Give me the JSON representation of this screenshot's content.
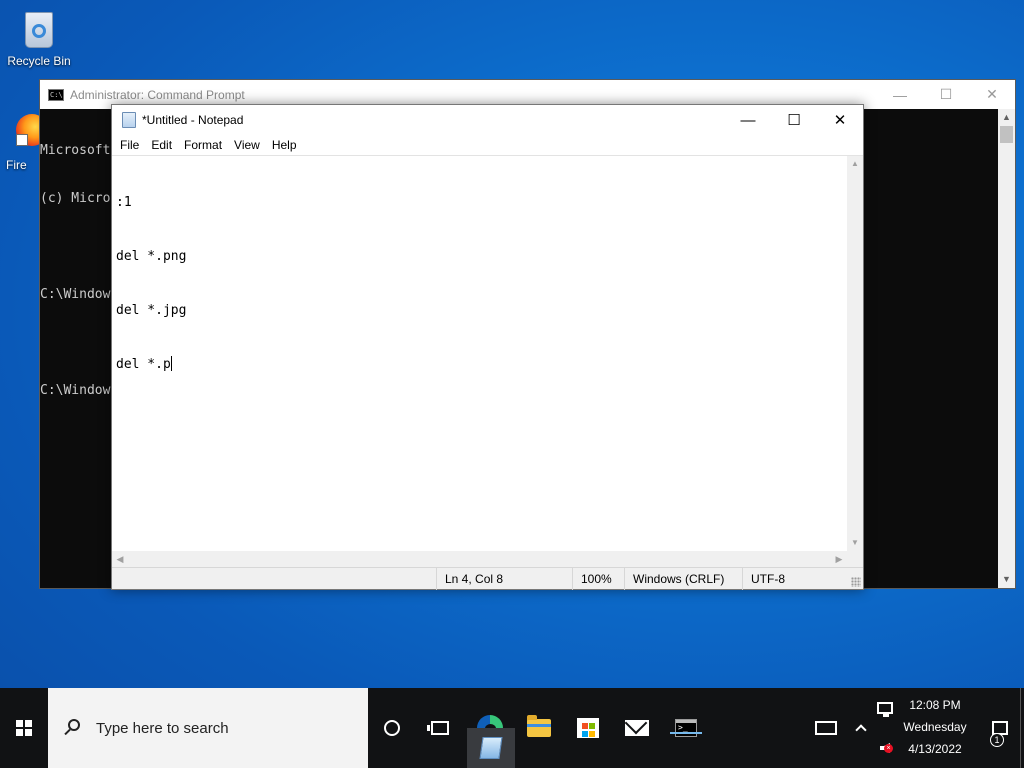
{
  "desktop": {
    "icons": [
      {
        "label": "Recycle Bin",
        "icon": "recycle-bin-icon"
      },
      {
        "label": "Fire",
        "icon": "firefox-icon"
      }
    ]
  },
  "cmd_window": {
    "title": "Administrator: Command Prompt",
    "console_lines": [
      "Microsoft",
      "(c) Micro",
      "",
      "C:\\Window",
      "",
      "C:\\Window"
    ],
    "controls": {
      "minimize": "—",
      "maximize": "☐",
      "close": "✕"
    }
  },
  "notepad": {
    "title": "*Untitled - Notepad",
    "menu": [
      "File",
      "Edit",
      "Format",
      "View",
      "Help"
    ],
    "content_lines": [
      ":1",
      "del *.png",
      "del *.jpg",
      "del *.p"
    ],
    "status": {
      "position": "Ln 4, Col 8",
      "zoom": "100%",
      "line_ending": "Windows (CRLF)",
      "encoding": "UTF-8"
    },
    "controls": {
      "minimize": "—",
      "maximize": "☐",
      "close": "✕"
    }
  },
  "taskbar": {
    "search_placeholder": "Type here to search",
    "pinned": [
      "cortana-icon",
      "task-view-icon",
      "edge-icon",
      "file-explorer-icon",
      "microsoft-store-icon",
      "mail-icon",
      "command-prompt-icon",
      "notepad-icon"
    ],
    "active_app": "notepad-icon",
    "clock": {
      "time": "12:08 PM",
      "day": "Wednesday",
      "date": "4/13/2022"
    },
    "notification_count": "1"
  },
  "colors": {
    "desktop_bg": "#0d6fce",
    "taskbar_bg": "#111214",
    "console_bg": "#0c0c0c",
    "accent_underline": "#76b9ed"
  }
}
